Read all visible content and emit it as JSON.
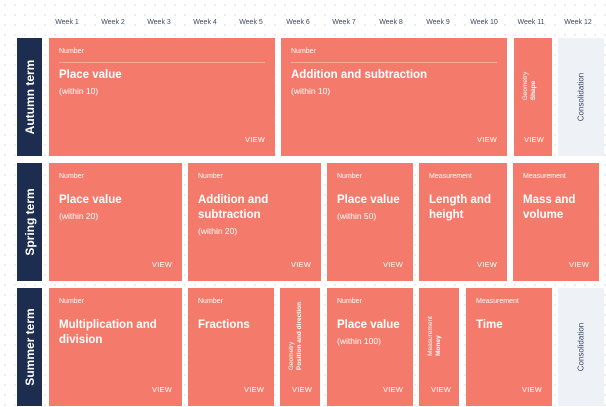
{
  "weeks": [
    "Week 1",
    "Week 2",
    "Week 3",
    "Week 4",
    "Week 5",
    "Week 6",
    "Week 7",
    "Week 8",
    "Week 9",
    "Week 10",
    "Week 11",
    "Week 12"
  ],
  "terms": {
    "autumn": "Autumn term",
    "spring": "Spring term",
    "summer": "Summer term"
  },
  "view_label": "VIEW",
  "autumn": {
    "b1": {
      "category": "Number",
      "title": "Place value",
      "sub": "(within 10)"
    },
    "b2": {
      "category": "Number",
      "title": "Addition and subtraction",
      "sub": "(within 10)"
    },
    "b3": {
      "category": "Geometry",
      "title": "Shape"
    },
    "consolidation": "Consolidation"
  },
  "spring": {
    "b1": {
      "category": "Number",
      "title": "Place value",
      "sub": "(within 20)"
    },
    "b2": {
      "category": "Number",
      "title": "Addition and subtraction",
      "sub": "(within 20)"
    },
    "b3": {
      "category": "Number",
      "title": "Place value",
      "sub": "(within 50)"
    },
    "b4": {
      "category": "Measurement",
      "title": "Length and height"
    },
    "b5": {
      "category": "Measurement",
      "title": "Mass and volume"
    }
  },
  "summer": {
    "b1": {
      "category": "Number",
      "title": "Multiplication and division"
    },
    "b2": {
      "category": "Number",
      "title": "Fractions"
    },
    "b3": {
      "category": "Geometry",
      "title": "Position and direction"
    },
    "b4": {
      "category": "Number",
      "title": "Place value",
      "sub": "(within 100)"
    },
    "b5": {
      "category": "Measurement",
      "title": "Money"
    },
    "b6": {
      "category": "Measurement",
      "title": "Time"
    },
    "consolidation": "Consolidation"
  }
}
